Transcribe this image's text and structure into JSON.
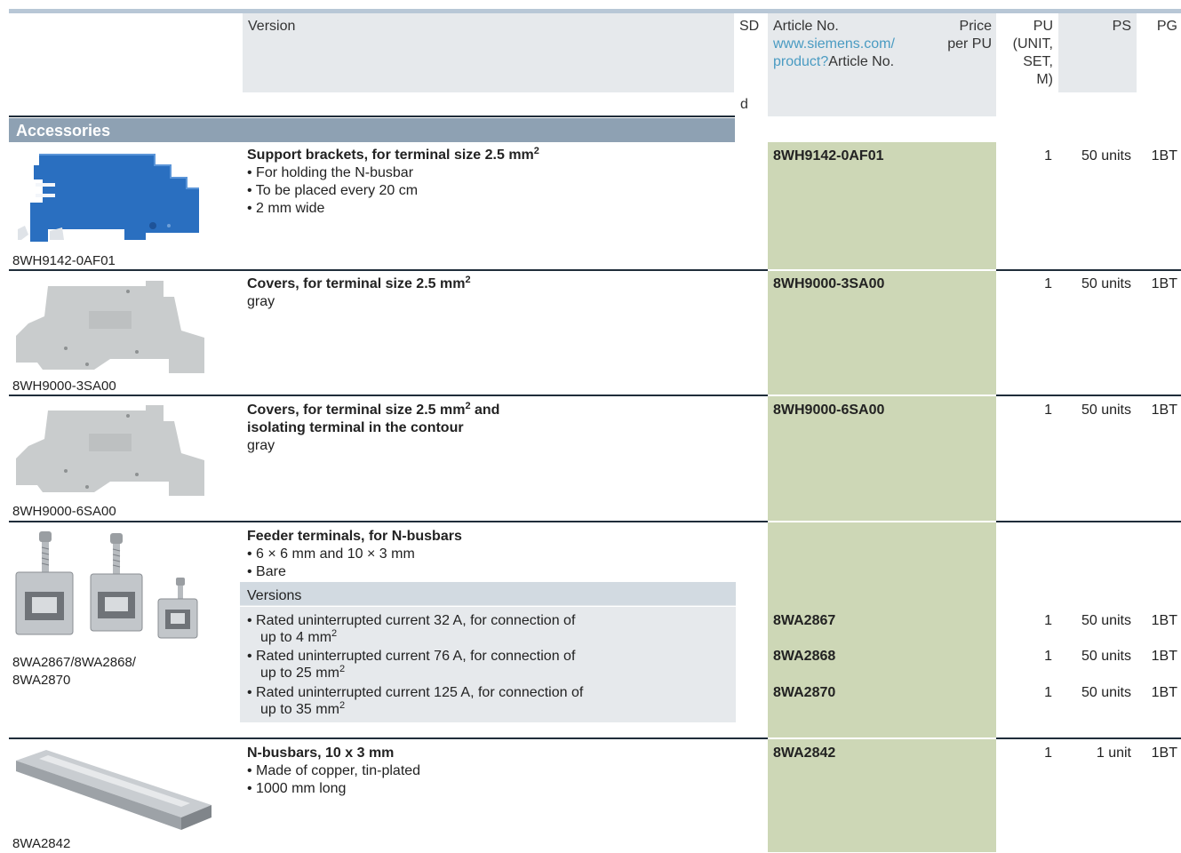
{
  "header": {
    "version": "Version",
    "sd": "SD",
    "sd_d": "d",
    "article_no": "Article No.",
    "article_link_1": "www.siemens.com/",
    "article_link_2": "product?",
    "article_link_suffix": "Article No.",
    "price_1": "Price",
    "price_2": "per PU",
    "pu_1": "PU",
    "pu_2": "(UNIT,",
    "pu_3": "SET,",
    "pu_4": "M)",
    "ps": "PS",
    "pg": "PG"
  },
  "section": {
    "title": "Accessories"
  },
  "rows": [
    {
      "caption": "8WH9142-0AF01",
      "title": "Support brackets, for terminal size 2.5 mm",
      "sup": "2",
      "bullets": [
        "• For holding the N-busbar",
        "• To be placed every 20 cm",
        "• 2 mm wide"
      ],
      "article": "8WH9142-0AF01",
      "pu": "1",
      "ps": "50 units",
      "pg": "1BT"
    },
    {
      "caption": "8WH9000-3SA00",
      "title": "Covers, for terminal size 2.5 mm",
      "sup": "2",
      "sub": "gray",
      "article": "8WH9000-3SA00",
      "pu": "1",
      "ps": "50 units",
      "pg": "1BT"
    },
    {
      "caption": "8WH9000-6SA00",
      "title_a": "Covers, for terminal size 2.5 mm",
      "sup": "2",
      "title_b": " and",
      "title_line2": "isolating terminal in the contour",
      "sub": "gray",
      "article": "8WH9000-6SA00",
      "pu": "1",
      "ps": "50 units",
      "pg": "1BT"
    },
    {
      "caption_1": "8WA2867/8WA2868/",
      "caption_2": "8WA2870",
      "title": "Feeder terminals, for N-busbars",
      "bullets": [
        "• 6 × 6 mm and 10 × 3 mm",
        "• Bare"
      ],
      "versions_label": "Versions",
      "versions": [
        {
          "line1": "• Rated uninterrupted current 32 A, for connection of",
          "line2": "up to 4 mm",
          "sup": "2",
          "article": "8WA2867",
          "pu": "1",
          "ps": "50 units",
          "pg": "1BT"
        },
        {
          "line1": "• Rated uninterrupted current 76 A, for connection of",
          "line2": "up to 25 mm",
          "sup": "2",
          "article": "8WA2868",
          "pu": "1",
          "ps": "50 units",
          "pg": "1BT"
        },
        {
          "line1": "• Rated uninterrupted current 125 A, for connection of",
          "line2": "up to 35 mm",
          "sup": "2",
          "article": "8WA2870",
          "pu": "1",
          "ps": "50 units",
          "pg": "1BT"
        }
      ]
    },
    {
      "caption": "8WA2842",
      "title": "N-busbars, 10 x 3 mm",
      "bullets": [
        "• Made of copper, tin-plated",
        "• 1000 mm long"
      ],
      "article": "8WA2842",
      "pu": "1",
      "ps": "1 unit",
      "pg": "1BT"
    }
  ],
  "colors": {
    "article_bg": "#cdd7b6",
    "header_bg": "#e6e9ec",
    "section_bg": "#8ea1b3",
    "link": "#4a9bc2"
  }
}
